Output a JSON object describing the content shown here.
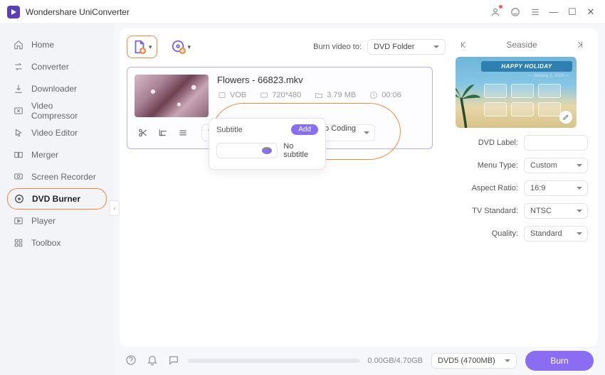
{
  "app": {
    "title": "Wondershare UniConverter"
  },
  "sidebar": {
    "items": [
      {
        "label": "Home"
      },
      {
        "label": "Converter"
      },
      {
        "label": "Downloader"
      },
      {
        "label": "Video Compressor"
      },
      {
        "label": "Video Editor"
      },
      {
        "label": "Merger"
      },
      {
        "label": "Screen Recorder"
      },
      {
        "label": "DVD Burner"
      },
      {
        "label": "Player"
      },
      {
        "label": "Toolbox"
      }
    ]
  },
  "toolbar": {
    "burn_to_label": "Burn video to:",
    "burn_to_value": "DVD Folder"
  },
  "file": {
    "title": "Flowers - 66823.mkv",
    "format": "VOB",
    "resolution": "720*480",
    "size": "3.79 MB",
    "duration": "00:06",
    "subtitle_value": "No subtitle",
    "audio_value": "Audio Coding 3"
  },
  "subtitle_popup": {
    "heading": "Subtitle",
    "add_label": "Add",
    "option_none": "No subtitle"
  },
  "template": {
    "name": "Seaside",
    "banner": "HAPPY HOLIDAY",
    "date": "— January 1, 2020 —"
  },
  "settings": {
    "dvd_label": {
      "lbl": "DVD Label:",
      "value": ""
    },
    "menu_type": {
      "lbl": "Menu Type:",
      "value": "Custom"
    },
    "aspect": {
      "lbl": "Aspect Ratio:",
      "value": "16:9"
    },
    "tv": {
      "lbl": "TV Standard:",
      "value": "NTSC"
    },
    "quality": {
      "lbl": "Quality:",
      "value": "Standard"
    }
  },
  "footer": {
    "progress": "0.00GB/4.70GB",
    "disc": "DVD5 (4700MB)",
    "burn": "Burn"
  }
}
